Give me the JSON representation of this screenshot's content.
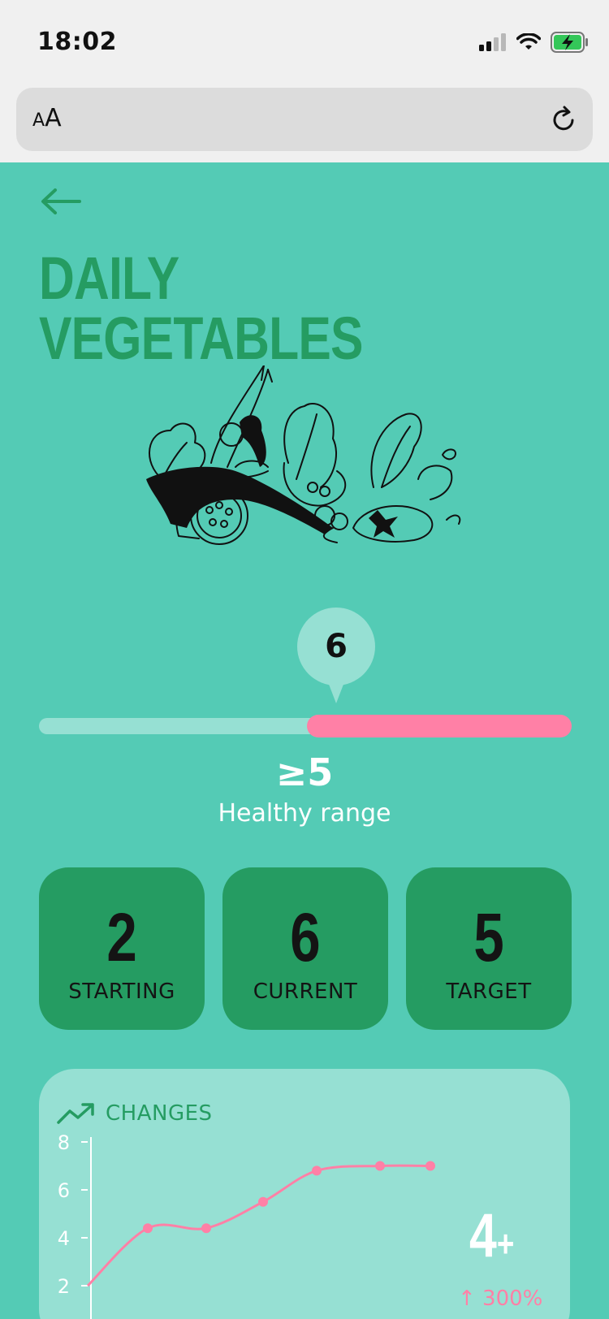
{
  "status": {
    "time": "18:02"
  },
  "browser": {
    "text_size_label_small": "A",
    "text_size_label_large": "A"
  },
  "page": {
    "title": "DAILY VEGETABLES",
    "slider": {
      "current_value": "6",
      "min": 0,
      "max": 10,
      "healthy_threshold": 5,
      "range_value": "≥5",
      "range_label": "Healthy range"
    },
    "stats": [
      {
        "value": "2",
        "label": "STARTING"
      },
      {
        "value": "6",
        "label": "CURRENT"
      },
      {
        "value": "5",
        "label": "TARGET"
      }
    ],
    "changes": {
      "title": "CHANGES",
      "big_value": "4",
      "big_suffix": "+",
      "percent": "↑ 300%"
    }
  },
  "colors": {
    "background": "#54CBB5",
    "dark_green": "#259C62",
    "light_teal": "#96E0D3",
    "pink": "#FF80A6"
  },
  "chart_data": {
    "type": "line",
    "title": "CHANGES",
    "xlabel": "",
    "ylabel": "",
    "y_ticks": [
      "8",
      "6",
      "4",
      "2"
    ],
    "ylim": [
      0,
      8
    ],
    "series": [
      {
        "values": [
          2,
          4.4,
          4.4,
          5.5,
          6.8,
          7.0,
          7.0
        ]
      }
    ],
    "grid": false
  }
}
